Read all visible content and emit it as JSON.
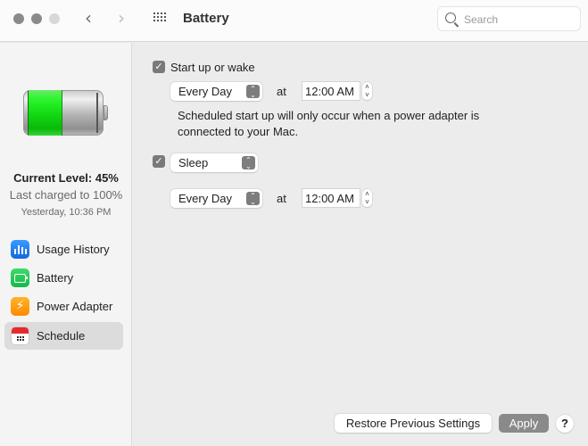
{
  "window": {
    "title": "Battery",
    "search_placeholder": "Search",
    "nav_back": "‹",
    "nav_forward": "›"
  },
  "sidebar": {
    "battery_level_fraction": 0.45,
    "current_level": "Current Level: 45%",
    "last_charged": "Last charged to 100%",
    "last_charged_time": "Yesterday, 10:36 PM",
    "items": [
      {
        "label": "Usage History",
        "icon": "usage-history-icon",
        "selected": false
      },
      {
        "label": "Battery",
        "icon": "battery-icon",
        "selected": false
      },
      {
        "label": "Power Adapter",
        "icon": "power-adapter-icon",
        "selected": false
      },
      {
        "label": "Schedule",
        "icon": "schedule-icon",
        "selected": true
      }
    ]
  },
  "schedule": {
    "startup": {
      "checked": true,
      "label": "Start up or wake",
      "frequency": "Every Day",
      "at_label": "at",
      "time": "12:00 AM",
      "note": "Scheduled start up will only occur when a power adapter is connected to your Mac."
    },
    "sleep": {
      "checked": true,
      "action": "Sleep",
      "frequency": "Every Day",
      "at_label": "at",
      "time": "12:00 AM"
    }
  },
  "footer": {
    "restore_label": "Restore Previous Settings",
    "apply_label": "Apply",
    "help_label": "?"
  },
  "glyphs": {
    "check": "✓",
    "popup_arrows": "⌃⌄",
    "stepper_up": "˄",
    "stepper_down": "˅",
    "bolt": "⚡"
  }
}
